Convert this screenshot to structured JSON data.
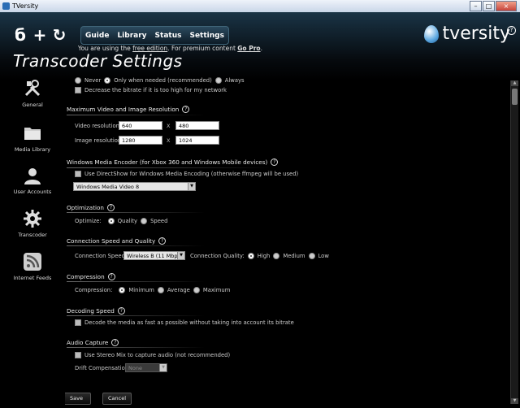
{
  "window": {
    "title": "TVersity",
    "minimize": "–",
    "maximize": "□",
    "close": "×"
  },
  "toolbar_icons": {
    "back": "б",
    "add": "+",
    "refresh": "↻"
  },
  "nav": {
    "items": [
      "Guide",
      "Library",
      "Status",
      "Settings"
    ]
  },
  "notice": {
    "prefix": "You are using the",
    "link": "free edition",
    "middle": ". For premium content",
    "go_pro": "Go Pro",
    "suffix": "."
  },
  "logo": {
    "text": "tversity"
  },
  "help": "?",
  "page_title": "Transcoder Settings",
  "sidebar": {
    "items": [
      {
        "label": "General",
        "icon": "tools-icon"
      },
      {
        "label": "Media Library",
        "icon": "folder-icon"
      },
      {
        "label": "User Accounts",
        "icon": "user-icon"
      },
      {
        "label": "Transcoder",
        "icon": "gear-icon"
      },
      {
        "label": "Internet Feeds",
        "icon": "rss-icon"
      }
    ]
  },
  "partial_row": {
    "opt1": "Never",
    "opt2": "Only when needed (recommended)",
    "opt3": "Always"
  },
  "decrease_bitrate": "Decrease the bitrate if it is too high for my network",
  "resolution": {
    "title": "Maximum Video and Image Resolution",
    "video_label": "Video resolution:",
    "video_w": "640",
    "video_h": "480",
    "image_label": "Image resolution:",
    "image_w": "1280",
    "image_h": "1024",
    "x": "X"
  },
  "wme": {
    "title": "Windows Media Encoder (for Xbox 360 and Windows Mobile devices)",
    "checkbox": "Use DirectShow for Windows Media Encoding (otherwise ffmpeg will be used)",
    "select": "Windows Media Video 8"
  },
  "optimization": {
    "title": "Optimization",
    "label": "Optimize:",
    "opt1": "Quality",
    "opt2": "Speed"
  },
  "connection": {
    "title": "Connection Speed and Quality",
    "speed_label": "Connection Speed:",
    "speed_value": "Wireless B (11 Mbps)",
    "quality_label": "Connection Quality:",
    "q1": "High",
    "q2": "Medium",
    "q3": "Low"
  },
  "compression": {
    "title": "Compression",
    "label": "Compression:",
    "opt1": "Minimum",
    "opt2": "Average",
    "opt3": "Maximum"
  },
  "decoding": {
    "title": "Decoding Speed",
    "checkbox": "Decode the media as fast as possible without taking into account its bitrate"
  },
  "audio": {
    "title": "Audio Capture",
    "checkbox": "Use Stereo Mix to capture audio (not recommended)",
    "drift_label": "Drift Compensation:",
    "drift_value": "None"
  },
  "buttons": {
    "save": "Save",
    "cancel": "Cancel"
  },
  "scroll": {
    "up": "▲",
    "down": "▼"
  },
  "colors": {
    "accent": "#5ba7e0",
    "background": "#000000"
  }
}
